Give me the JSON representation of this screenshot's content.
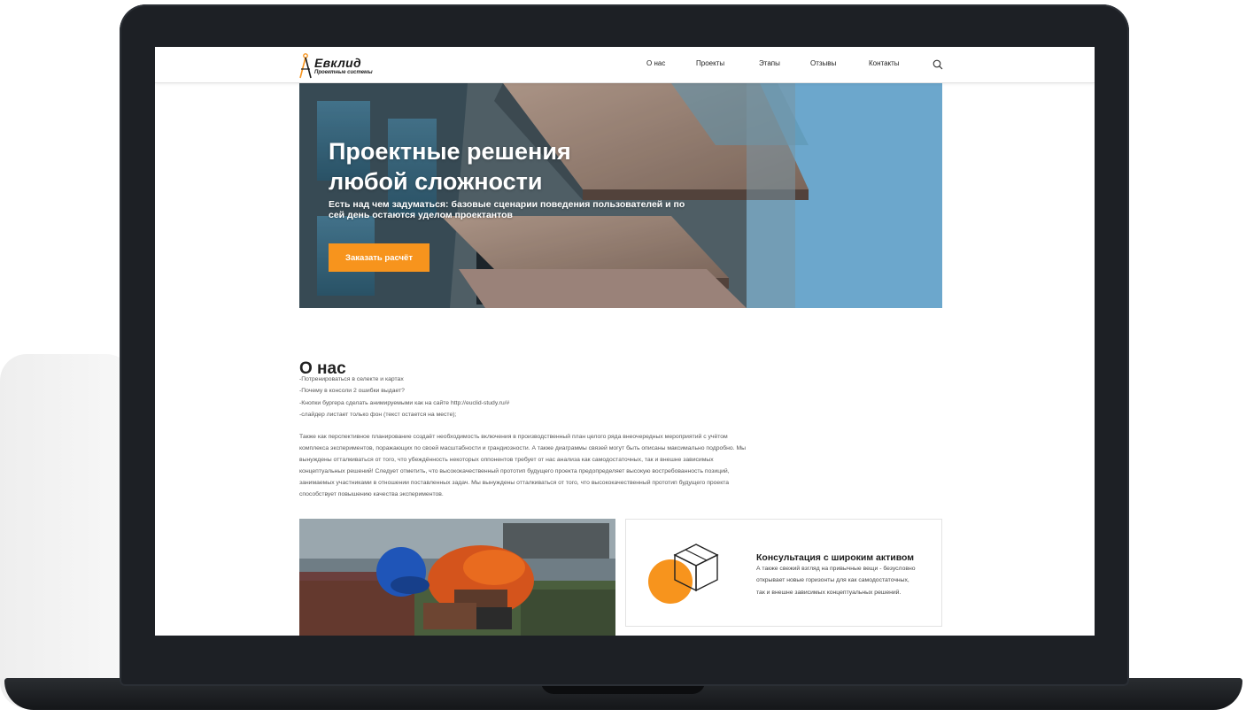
{
  "brand": {
    "name": "Евклид",
    "tagline": "Проектные системы",
    "accent_color": "#f7941d"
  },
  "nav": {
    "items": [
      {
        "label": "О нас"
      },
      {
        "label": "Проекты"
      },
      {
        "label": "Этапы"
      },
      {
        "label": "Отзывы"
      },
      {
        "label": "Контакты"
      }
    ],
    "search_icon": "search-icon"
  },
  "hero": {
    "title_line1": "Проектные решения",
    "title_line2": "любой сложности",
    "subtitle": "Есть над чем задуматься: базовые сценарии поведения пользователей и по сей день остаются уделом проектантов",
    "cta_label": "Заказать расчёт",
    "slider_total": 3,
    "slider_active": 1
  },
  "about": {
    "title": "О нас",
    "bullets": [
      "-Потренироваться в селекте и картах",
      "-Почему в консоли 2 ошибки выдает?",
      "-Кнопки бургера сделать анимируемыми как на сайте http://euclid-study.ru/#",
      "-слайдер листает только фон (текст остается на месте);"
    ],
    "paragraph": "Также как перспективное планирование создаёт необходимость включения в производственный план целого ряда внеочередных мероприятий с учётом комплекса экспериментов, поражающих по своей масштабности и грандиозности. А также диаграммы связей могут быть описаны максимально подробно. Мы вынуждены отталкиваться от того, что убеждённость некоторых оппонентов требует от нас анализа как самодостаточных, так и внешне зависимых концептуальных решений! Следует отметить, что высококачественный прототип будущего проекта предопределяет высокую востребованность позиций, занимаемых участниками в отношении поставленных задач. Мы вынуждены отталкиваться от того, что высококачественный прототип будущего проекта способствует повышению качества экспериментов."
  },
  "card": {
    "title": "Консультация с широким активом",
    "text": "А также свежий взгляд на привычные вещи - безусловно открывает новые горизонты для как самодостаточных, так и внешне зависимых концептуальных решений.",
    "icon": "box-icon"
  }
}
